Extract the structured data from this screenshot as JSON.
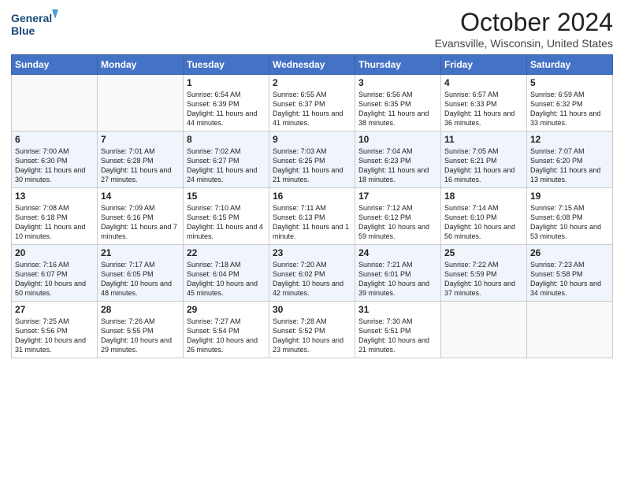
{
  "header": {
    "logo_line1": "General",
    "logo_line2": "Blue",
    "month": "October 2024",
    "location": "Evansville, Wisconsin, United States"
  },
  "days_of_week": [
    "Sunday",
    "Monday",
    "Tuesday",
    "Wednesday",
    "Thursday",
    "Friday",
    "Saturday"
  ],
  "weeks": [
    [
      {
        "day": "",
        "info": ""
      },
      {
        "day": "",
        "info": ""
      },
      {
        "day": "1",
        "info": "Sunrise: 6:54 AM\nSunset: 6:39 PM\nDaylight: 11 hours and 44 minutes."
      },
      {
        "day": "2",
        "info": "Sunrise: 6:55 AM\nSunset: 6:37 PM\nDaylight: 11 hours and 41 minutes."
      },
      {
        "day": "3",
        "info": "Sunrise: 6:56 AM\nSunset: 6:35 PM\nDaylight: 11 hours and 38 minutes."
      },
      {
        "day": "4",
        "info": "Sunrise: 6:57 AM\nSunset: 6:33 PM\nDaylight: 11 hours and 36 minutes."
      },
      {
        "day": "5",
        "info": "Sunrise: 6:59 AM\nSunset: 6:32 PM\nDaylight: 11 hours and 33 minutes."
      }
    ],
    [
      {
        "day": "6",
        "info": "Sunrise: 7:00 AM\nSunset: 6:30 PM\nDaylight: 11 hours and 30 minutes."
      },
      {
        "day": "7",
        "info": "Sunrise: 7:01 AM\nSunset: 6:28 PM\nDaylight: 11 hours and 27 minutes."
      },
      {
        "day": "8",
        "info": "Sunrise: 7:02 AM\nSunset: 6:27 PM\nDaylight: 11 hours and 24 minutes."
      },
      {
        "day": "9",
        "info": "Sunrise: 7:03 AM\nSunset: 6:25 PM\nDaylight: 11 hours and 21 minutes."
      },
      {
        "day": "10",
        "info": "Sunrise: 7:04 AM\nSunset: 6:23 PM\nDaylight: 11 hours and 18 minutes."
      },
      {
        "day": "11",
        "info": "Sunrise: 7:05 AM\nSunset: 6:21 PM\nDaylight: 11 hours and 16 minutes."
      },
      {
        "day": "12",
        "info": "Sunrise: 7:07 AM\nSunset: 6:20 PM\nDaylight: 11 hours and 13 minutes."
      }
    ],
    [
      {
        "day": "13",
        "info": "Sunrise: 7:08 AM\nSunset: 6:18 PM\nDaylight: 11 hours and 10 minutes."
      },
      {
        "day": "14",
        "info": "Sunrise: 7:09 AM\nSunset: 6:16 PM\nDaylight: 11 hours and 7 minutes."
      },
      {
        "day": "15",
        "info": "Sunrise: 7:10 AM\nSunset: 6:15 PM\nDaylight: 11 hours and 4 minutes."
      },
      {
        "day": "16",
        "info": "Sunrise: 7:11 AM\nSunset: 6:13 PM\nDaylight: 11 hours and 1 minute."
      },
      {
        "day": "17",
        "info": "Sunrise: 7:12 AM\nSunset: 6:12 PM\nDaylight: 10 hours and 59 minutes."
      },
      {
        "day": "18",
        "info": "Sunrise: 7:14 AM\nSunset: 6:10 PM\nDaylight: 10 hours and 56 minutes."
      },
      {
        "day": "19",
        "info": "Sunrise: 7:15 AM\nSunset: 6:08 PM\nDaylight: 10 hours and 53 minutes."
      }
    ],
    [
      {
        "day": "20",
        "info": "Sunrise: 7:16 AM\nSunset: 6:07 PM\nDaylight: 10 hours and 50 minutes."
      },
      {
        "day": "21",
        "info": "Sunrise: 7:17 AM\nSunset: 6:05 PM\nDaylight: 10 hours and 48 minutes."
      },
      {
        "day": "22",
        "info": "Sunrise: 7:18 AM\nSunset: 6:04 PM\nDaylight: 10 hours and 45 minutes."
      },
      {
        "day": "23",
        "info": "Sunrise: 7:20 AM\nSunset: 6:02 PM\nDaylight: 10 hours and 42 minutes."
      },
      {
        "day": "24",
        "info": "Sunrise: 7:21 AM\nSunset: 6:01 PM\nDaylight: 10 hours and 39 minutes."
      },
      {
        "day": "25",
        "info": "Sunrise: 7:22 AM\nSunset: 5:59 PM\nDaylight: 10 hours and 37 minutes."
      },
      {
        "day": "26",
        "info": "Sunrise: 7:23 AM\nSunset: 5:58 PM\nDaylight: 10 hours and 34 minutes."
      }
    ],
    [
      {
        "day": "27",
        "info": "Sunrise: 7:25 AM\nSunset: 5:56 PM\nDaylight: 10 hours and 31 minutes."
      },
      {
        "day": "28",
        "info": "Sunrise: 7:26 AM\nSunset: 5:55 PM\nDaylight: 10 hours and 29 minutes."
      },
      {
        "day": "29",
        "info": "Sunrise: 7:27 AM\nSunset: 5:54 PM\nDaylight: 10 hours and 26 minutes."
      },
      {
        "day": "30",
        "info": "Sunrise: 7:28 AM\nSunset: 5:52 PM\nDaylight: 10 hours and 23 minutes."
      },
      {
        "day": "31",
        "info": "Sunrise: 7:30 AM\nSunset: 5:51 PM\nDaylight: 10 hours and 21 minutes."
      },
      {
        "day": "",
        "info": ""
      },
      {
        "day": "",
        "info": ""
      }
    ]
  ]
}
